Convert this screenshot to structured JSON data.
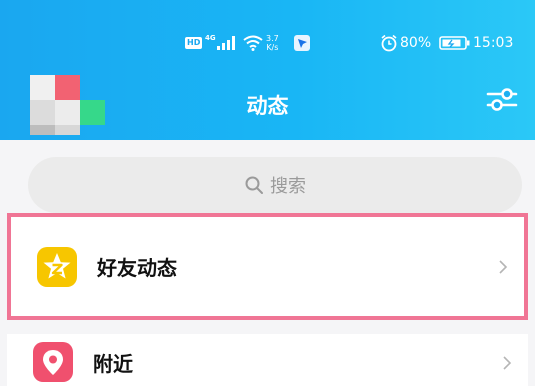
{
  "status_bar": {
    "hd": "HD",
    "network": "4G",
    "speed_value": "3.7",
    "speed_unit": "K/s",
    "battery": "80%",
    "time": "15:03"
  },
  "header": {
    "title": "动态"
  },
  "search": {
    "placeholder": "搜索"
  },
  "rows": [
    {
      "label": "好友动态",
      "icon": "qzone-star-icon",
      "color": "#f7c600",
      "highlighted": true
    },
    {
      "label": "附近",
      "icon": "location-pin-icon",
      "color": "#f0506e",
      "highlighted": false
    }
  ],
  "colors": {
    "header": "#1aa7f0",
    "highlight_border": "#f07595"
  }
}
